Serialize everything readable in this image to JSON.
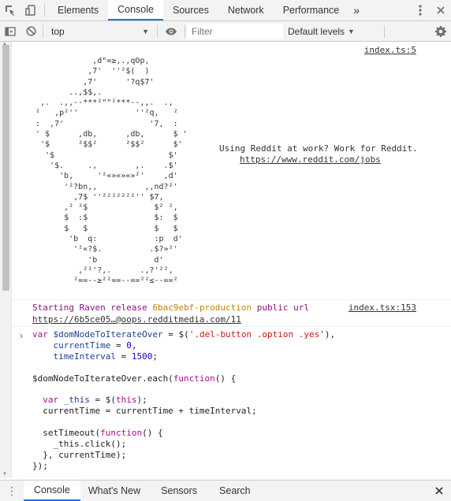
{
  "topbar": {
    "tabs": [
      {
        "label": "Elements",
        "selected": false
      },
      {
        "label": "Console",
        "selected": true
      },
      {
        "label": "Sources",
        "selected": false
      },
      {
        "label": "Network",
        "selected": false
      },
      {
        "label": "Performance",
        "selected": false
      }
    ],
    "more_icon": "chevron-double-right-icon",
    "icons": [
      "inspect-element-icon",
      "device-toolbar-icon",
      "more-menu-icon",
      "close-icon"
    ]
  },
  "toolbar": {
    "context_value": "top",
    "filter_placeholder": "Filter",
    "levels_label": "Default levels",
    "icons": [
      "sidebar-toggle-icon",
      "clear-console-icon",
      "eye-icon",
      "settings-gear-icon"
    ]
  },
  "console": {
    "message1": {
      "source": "index.ts:5",
      "ascii_art": "            ,d\"=≥,.,qOp,\n           ,7'  ''²$(  )\n          ,7'      '?q$7'\n       ..,$$,.\n ,.  .,,--***²\"\"²***--,,.  .,\n²   ,p²''            ''²q,   ²\n:  ,7'                  '7,  :\n' $      ,db,      ,db,      $ '\n '$      ²$$²      ²$$²      $'\n  '$                        $'\n   '$.     .,        ,.    .$'\n     'b,     '²«»«»«»²'    ,d'\n      '²?bn,,          ,,nd?²'\n        ,7$ ''²²²²²²²'' $7,\n      ,² ²$              $² ²,\n      $  :$              $:  $\n      $   $              $   $\n       'b  q:            :p  d'\n        '²«?$.          .$?»²'\n           'b            d'\n         ,²²'?,.      .,?'²²,\n        ²==--≥²²==--==²²≤--==²",
      "reddit_text": "Using Reddit at work? Work for Reddit.",
      "reddit_link": "https://www.reddit.com/jobs"
    },
    "message2": {
      "source": "index.tsx:153",
      "text_prefix": "Starting Raven release",
      "release": "6bac9ebf-production",
      "text_suffix": "public url",
      "url": "https://6b5ce05…@oops.redditmedia.com/11"
    },
    "message3": {
      "prompt": "›"
    }
  },
  "drawer": {
    "tabs": [
      {
        "label": "Console",
        "selected": true
      },
      {
        "label": "What's New",
        "selected": false
      },
      {
        "label": "Sensors",
        "selected": false
      },
      {
        "label": "Search",
        "selected": false
      }
    ]
  }
}
